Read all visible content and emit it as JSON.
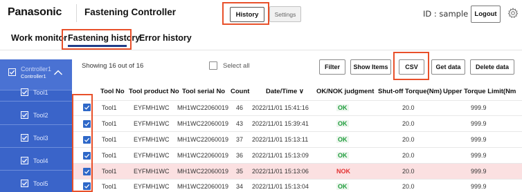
{
  "header": {
    "brand": "Panasonic",
    "app_title": "Fastening Controller",
    "history_label": "History",
    "settings_label": "Settings",
    "user_id": "ID : sample",
    "logout_label": "Logout"
  },
  "tabs": [
    {
      "label": "Work monitor"
    },
    {
      "label": "Fastening history"
    },
    {
      "label": "Error history"
    }
  ],
  "sidebar": {
    "controller_line1": "Controller1",
    "controller_line2": "Controller1",
    "tools": [
      "Tool1",
      "Tool2",
      "Tool3",
      "Tool4",
      "Tool5"
    ]
  },
  "toolbar": {
    "showing_text": "Showing 16 out of 16",
    "select_all_label": "Select all",
    "filter_label": "Filter",
    "show_items_label": "Show Items",
    "csv_label": "CSV",
    "get_data_label": "Get data",
    "delete_data_label": "Delete data"
  },
  "table": {
    "columns": [
      "Tool No",
      "Tool product No",
      "Tool serial No",
      "Count",
      "Date/Time ∨",
      "OK/NOK judgment",
      "Shut-off Torque(Nm)",
      "Upper Torque Limit(Nm"
    ],
    "rows": [
      {
        "tool_no": "Tool1",
        "product": "EYFMH1WC",
        "serial": "MH1WC22060019",
        "count": "46",
        "datetime": "2022/11/01 15:41:16",
        "judgment": "OK",
        "torque": "20.0",
        "upper": "999.9"
      },
      {
        "tool_no": "Tool1",
        "product": "EYFMH1WC",
        "serial": "MH1WC22060019",
        "count": "43",
        "datetime": "2022/11/01 15:39:41",
        "judgment": "OK",
        "torque": "20.0",
        "upper": "999.9"
      },
      {
        "tool_no": "Tool1",
        "product": "EYFMH1WC",
        "serial": "MH1WC22060019",
        "count": "37",
        "datetime": "2022/11/01 15:13:11",
        "judgment": "OK",
        "torque": "20.0",
        "upper": "999.9"
      },
      {
        "tool_no": "Tool1",
        "product": "EYFMH1WC",
        "serial": "MH1WC22060019",
        "count": "36",
        "datetime": "2022/11/01 15:13:09",
        "judgment": "OK",
        "torque": "20.0",
        "upper": "999.9"
      },
      {
        "tool_no": "Tool1",
        "product": "EYFMH1WC",
        "serial": "MH1WC22060019",
        "count": "35",
        "datetime": "2022/11/01 15:13:06",
        "judgment": "NOK",
        "torque": "20.0",
        "upper": "999.9"
      },
      {
        "tool_no": "Tool1",
        "product": "EYFMH1WC",
        "serial": "MH1WC22060019",
        "count": "34",
        "datetime": "2022/11/01 15:13:04",
        "judgment": "OK",
        "torque": "20.0",
        "upper": "999.9"
      }
    ]
  },
  "colors": {
    "sidebar_bg": "#3a64c9",
    "highlight": "#e8502a",
    "ok_text": "#1f9d3c",
    "nok_text": "#e23030",
    "nok_row_bg": "#fbe0e1",
    "checkbox_checked": "#2e68c8",
    "tab_underline": "#1f3c88"
  },
  "icons": {
    "settings": "gear-icon",
    "collapse": "chevron-up-icon",
    "checked": "checkmark-icon"
  }
}
